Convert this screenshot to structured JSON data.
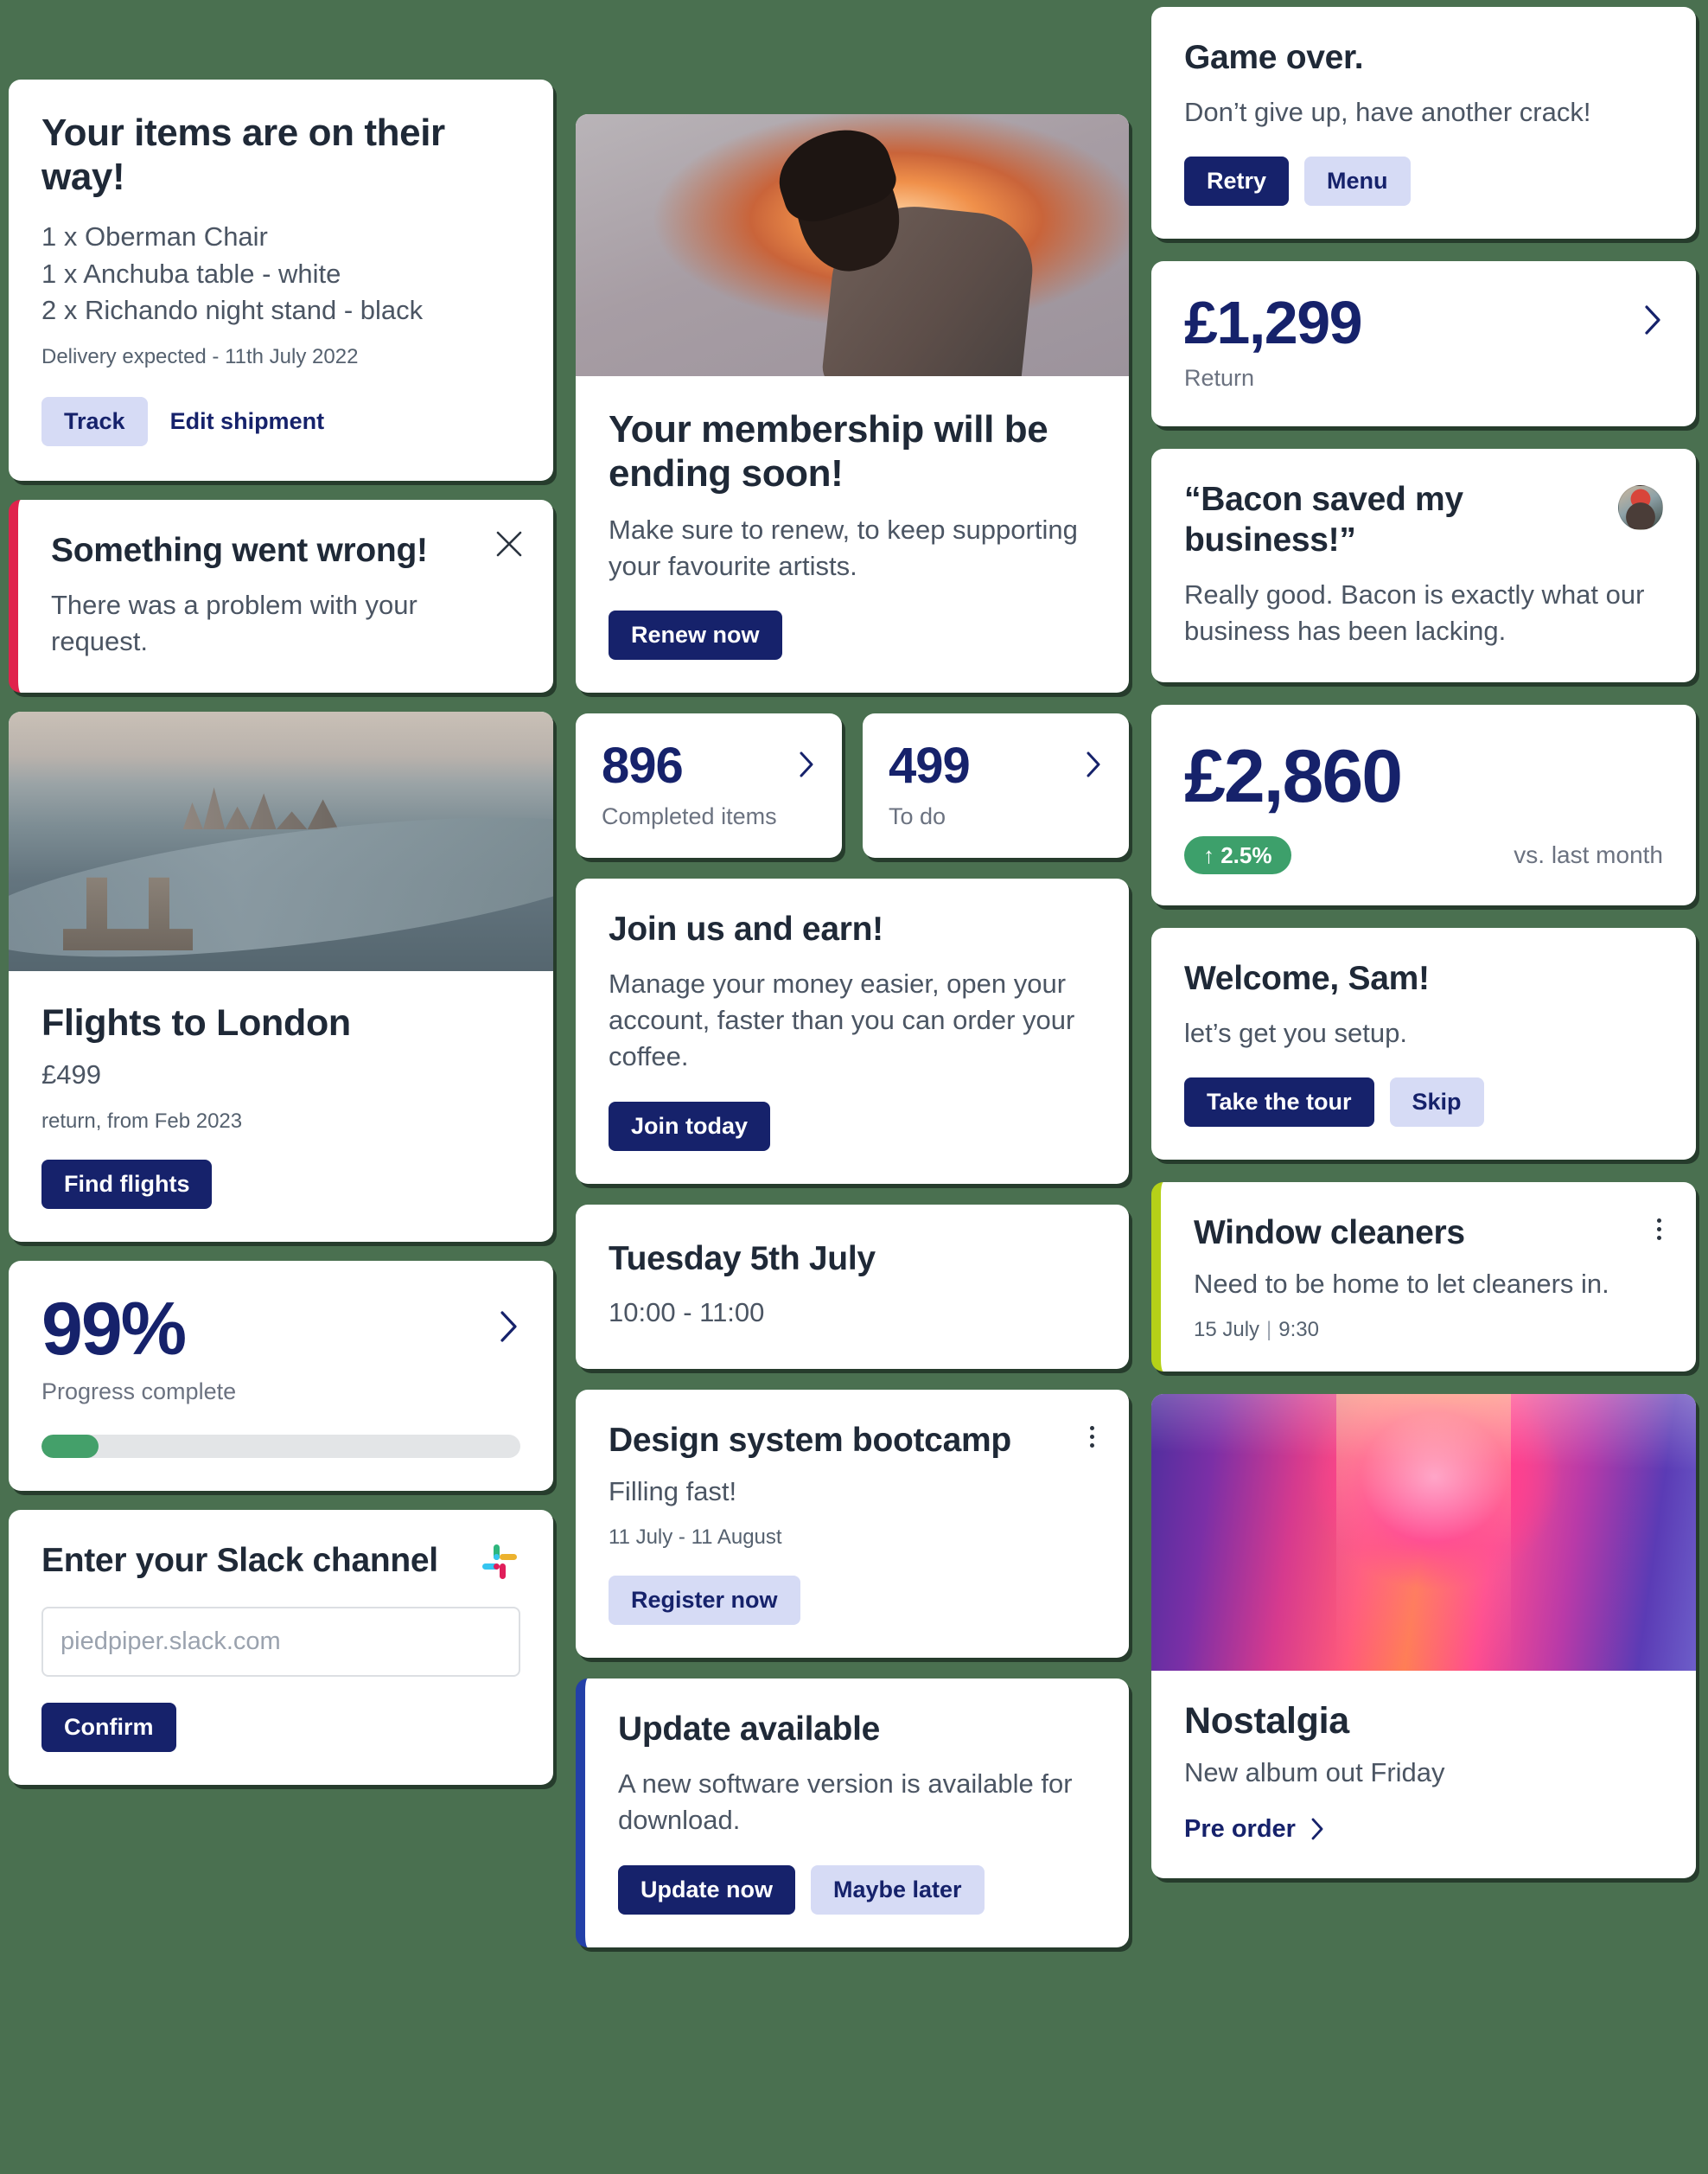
{
  "theme": {
    "background": "#4a7050",
    "card_bg": "#ffffff",
    "navy": "#16226b",
    "lavender": "#d6dbf5",
    "red_accent": "#e0234c",
    "blue_accent": "#2340a8",
    "lime_accent": "#b5d118",
    "green_pill": "#3da06b",
    "progress_green": "#44a06a"
  },
  "shipment": {
    "title": "Your items are on their way!",
    "items": [
      "1 x Oberman Chair",
      "1 x Anchuba table - white",
      "2 x Richando night stand - black"
    ],
    "delivery": "Delivery expected - 11th July 2022",
    "track_label": "Track",
    "edit_label": "Edit shipment"
  },
  "error": {
    "title": "Something went wrong!",
    "body": "There was a problem with your request.",
    "close_icon": "close-icon"
  },
  "flights": {
    "image_alt": "london-aerial-photo",
    "title": "Flights to London",
    "price": "£499",
    "detail": "return, from Feb 2023",
    "cta": "Find flights"
  },
  "progress": {
    "value": "99%",
    "label": "Progress complete",
    "fill_percent": 12,
    "chevron_icon": "chevron-right-icon"
  },
  "slack": {
    "title": "Enter your Slack channel",
    "logo_icon": "slack-logo-icon",
    "placeholder": "piedpiper.slack.com",
    "input_value": "",
    "confirm_label": "Confirm"
  },
  "membership": {
    "image_alt": "silhouette-person-orange-glow",
    "title": "Your membership will be ending soon!",
    "body": "Make sure to renew, to keep supporting your favourite artists.",
    "cta": "Renew now"
  },
  "stats": [
    {
      "value": "896",
      "label": "Completed items",
      "chevron_icon": "chevron-right-icon"
    },
    {
      "value": "499",
      "label": "To do",
      "chevron_icon": "chevron-right-icon"
    }
  ],
  "join": {
    "title": "Join us and earn!",
    "body": "Manage your money easier, open your account, faster than you can order your coffee.",
    "cta": "Join today"
  },
  "appointment": {
    "title": "Tuesday 5th July",
    "time": "10:00 - 11:00"
  },
  "bootcamp": {
    "title": "Design system bootcamp",
    "subtitle": "Filling fast!",
    "dates": "11 July - 11 August",
    "cta": "Register now",
    "menu_icon": "kebab-menu-icon"
  },
  "update": {
    "title": "Update available",
    "body": "A new software version is available for download.",
    "primary_cta": "Update now",
    "secondary_cta": "Maybe later"
  },
  "game_over": {
    "title": "Game over.",
    "body": "Don’t give up, have another crack!",
    "primary_cta": "Retry",
    "secondary_cta": "Menu"
  },
  "price_return": {
    "value": "£1,299",
    "label": "Return",
    "chevron_icon": "chevron-right-icon"
  },
  "testimonial": {
    "quote": "“Bacon saved my business!”",
    "body": "Really good. Bacon is exactly what our business has been lacking.",
    "avatar_icon": "avatar"
  },
  "revenue": {
    "value": "£2,860",
    "change": "↑  2.5%",
    "comparison": "vs. last month"
  },
  "welcome": {
    "title": "Welcome, Sam!",
    "body": "let’s get you setup.",
    "primary_cta": "Take the tour",
    "secondary_cta": "Skip"
  },
  "reminder": {
    "title": "Window cleaners",
    "body": "Need to be home to let cleaners in.",
    "date": "15 July",
    "separator": "|",
    "time": "9:30",
    "menu_icon": "kebab-menu-icon"
  },
  "album": {
    "image_alt": "neon-gradient-corridor",
    "title": "Nostalgia",
    "subtitle": "New album out Friday",
    "cta": "Pre order",
    "chevron_icon": "chevron-right-icon"
  }
}
